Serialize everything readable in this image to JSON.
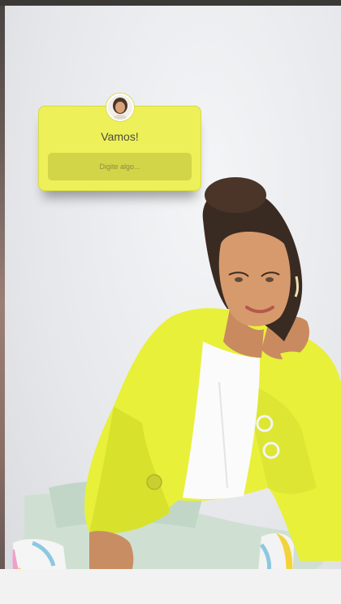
{
  "story": {
    "question_sticker": {
      "title": "Vamos!",
      "input_placeholder": "Digite algo...",
      "background_color": "#eef05a",
      "input_color": "#d3d548",
      "avatar_icon": "profile-avatar-icon"
    },
    "photo": {
      "subject": "woman-in-yellow-blazer",
      "jacket_color": "#e8f03a",
      "background_color": "#e9eaec"
    }
  }
}
